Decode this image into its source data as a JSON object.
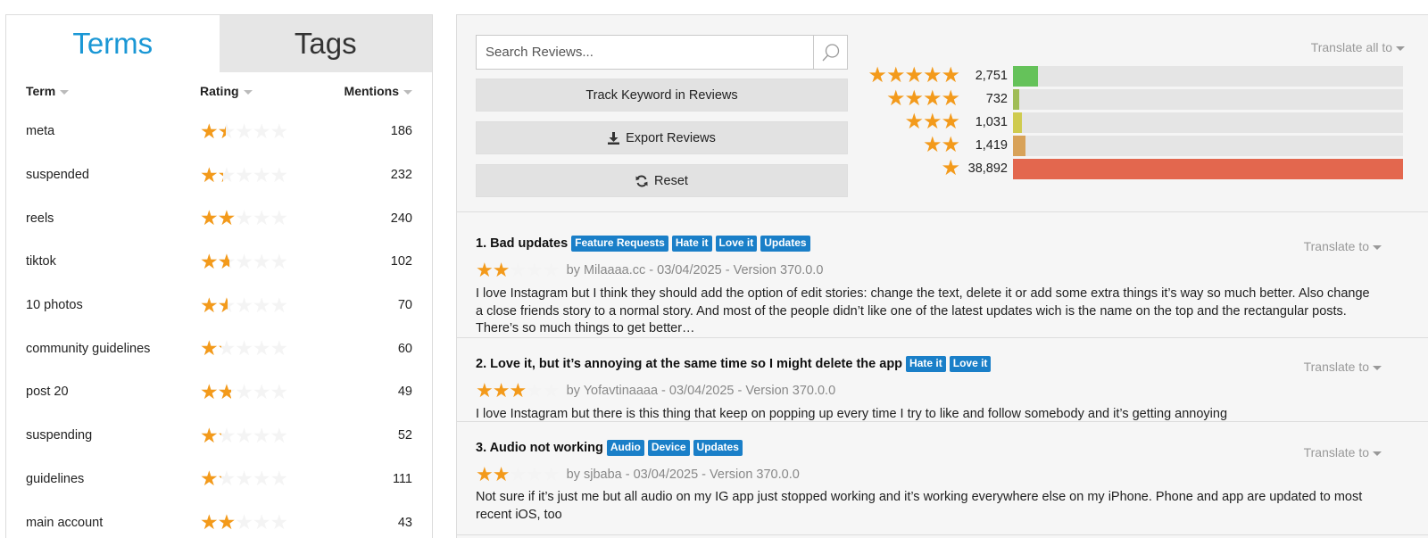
{
  "tabs": {
    "terms": "Terms",
    "tags": "Tags"
  },
  "terms_table": {
    "headers": {
      "term": "Term",
      "rating": "Rating",
      "mentions": "Mentions"
    },
    "rows": [
      {
        "term": "meta",
        "rating": 1.5,
        "mentions": "186"
      },
      {
        "term": "suspended",
        "rating": 1.3,
        "mentions": "232"
      },
      {
        "term": "reels",
        "rating": 2.0,
        "mentions": "240"
      },
      {
        "term": "tiktok",
        "rating": 1.7,
        "mentions": "102"
      },
      {
        "term": "10 photos",
        "rating": 1.6,
        "mentions": "70"
      },
      {
        "term": "community guidelines",
        "rating": 1.2,
        "mentions": "60"
      },
      {
        "term": "post 20",
        "rating": 1.8,
        "mentions": "49"
      },
      {
        "term": "suspending",
        "rating": 1.2,
        "mentions": "52"
      },
      {
        "term": "guidelines",
        "rating": 1.2,
        "mentions": "111"
      },
      {
        "term": "main account",
        "rating": 2.0,
        "mentions": "43"
      }
    ]
  },
  "search": {
    "placeholder": "Search Reviews..."
  },
  "buttons": {
    "track": "Track Keyword in Reviews",
    "export": "Export Reviews",
    "reset": "Reset"
  },
  "translate_all": "Translate all to",
  "distribution": [
    {
      "stars": 5,
      "count": "2,751",
      "fraction": 0.065,
      "color": "#65c25a"
    },
    {
      "stars": 4,
      "count": "732",
      "fraction": 0.017,
      "color": "#a0bd56"
    },
    {
      "stars": 3,
      "count": "1,031",
      "fraction": 0.024,
      "color": "#cfcb4f"
    },
    {
      "stars": 2,
      "count": "1,419",
      "fraction": 0.033,
      "color": "#d8a259"
    },
    {
      "stars": 1,
      "count": "38,892",
      "fraction": 1.0,
      "color": "#e3674e"
    }
  ],
  "reviews": [
    {
      "title": "1. Bad updates",
      "tags": [
        "Feature Requests",
        "Hate it",
        "Love it",
        "Updates"
      ],
      "rating": 2,
      "meta": "by Milaaaa.cc - 03/04/2025 - Version 370.0.0",
      "body": "I love Instagram but I think they should add the option of edit stories: change the text, delete it or add some extra things it’s way so much better. Also change a close friends story to a normal story. And most of the people didn’t like one of the latest updates wich is the name on the top and the rectangular posts. There’s so much things to get better…",
      "translate": "Translate to"
    },
    {
      "title": "2. Love it, but it’s annoying at the same time so I might delete the app",
      "tags": [
        "Hate it",
        "Love it"
      ],
      "rating": 3,
      "meta": "by Yofavtinaaaa - 03/04/2025 - Version 370.0.0",
      "body": "I love Instagram but there is this thing that keep on popping up every time I try to like and follow somebody and it’s getting annoying",
      "translate": "Translate to"
    },
    {
      "title": "3. Audio not working",
      "tags": [
        "Audio",
        "Device",
        "Updates"
      ],
      "rating": 2,
      "meta": "by sjbaba - 03/04/2025 - Version 370.0.0",
      "body": "Not sure if it’s just me but all audio on my IG app just stopped working and it’s working everywhere else on my iPhone. Phone and app are updated to most recent iOS, too",
      "translate": "Translate to"
    }
  ]
}
